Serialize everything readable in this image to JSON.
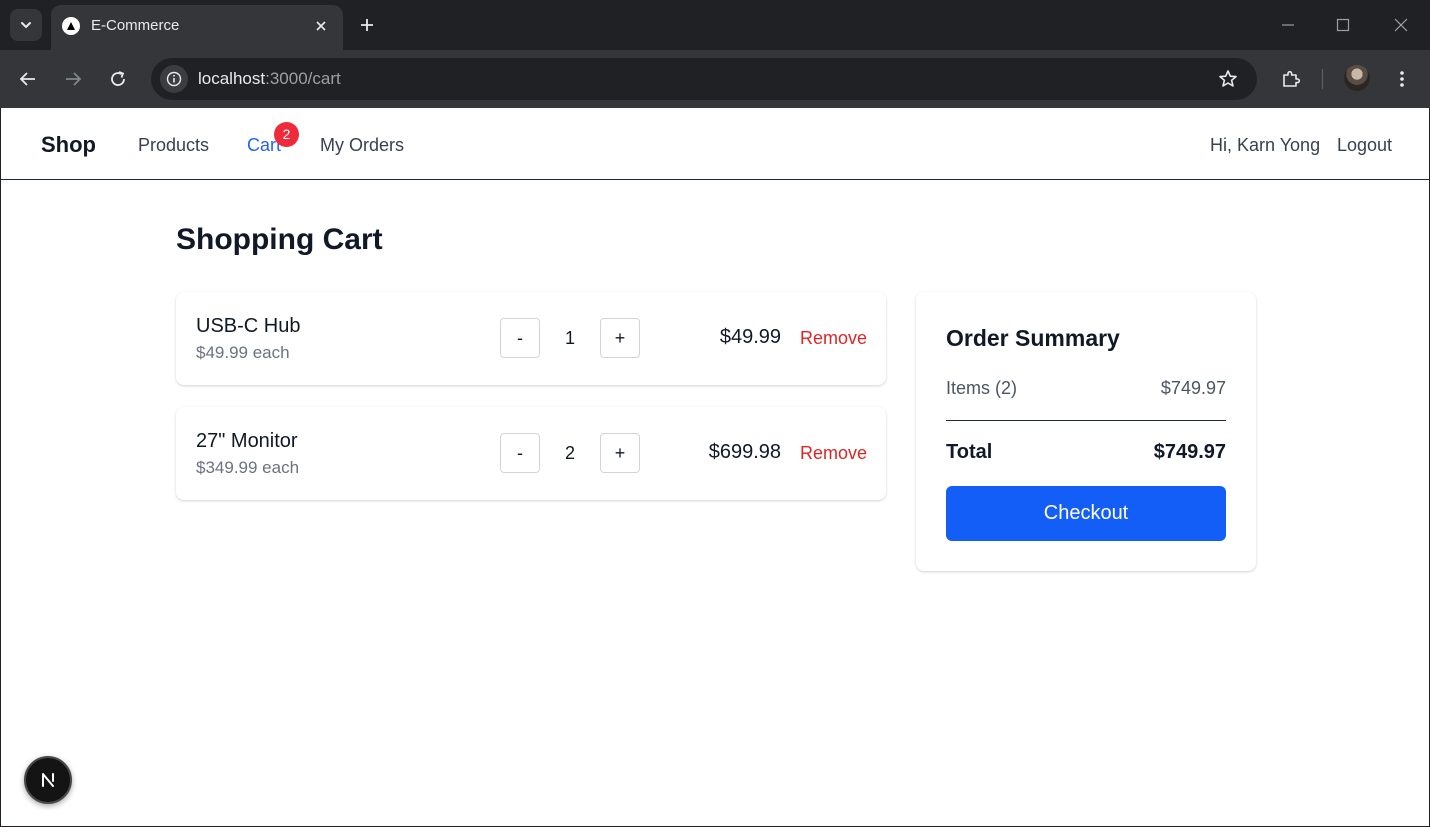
{
  "browser": {
    "tab_title": "E-Commerce",
    "url_host": "localhost",
    "url_path": ":3000/cart"
  },
  "nav": {
    "brand": "Shop",
    "products": "Products",
    "cart": "Cart",
    "cart_count": "2",
    "orders": "My Orders",
    "greeting": "Hi, Karn Yong",
    "logout": "Logout"
  },
  "page": {
    "title": "Shopping Cart"
  },
  "cart": {
    "items": [
      {
        "name": "USB-C Hub",
        "each": "$49.99 each",
        "qty": "1",
        "line_total": "$49.99",
        "minus": "-",
        "plus": "+",
        "remove": "Remove"
      },
      {
        "name": "27\" Monitor",
        "each": "$349.99 each",
        "qty": "2",
        "line_total": "$699.98",
        "minus": "-",
        "plus": "+",
        "remove": "Remove"
      }
    ]
  },
  "summary": {
    "title": "Order Summary",
    "items_label": "Items (2)",
    "items_value": "$749.97",
    "total_label": "Total",
    "total_value": "$749.97",
    "checkout": "Checkout"
  },
  "icons": {
    "next_dev": "N"
  },
  "colors": {
    "primary": "#135ef7",
    "link_active": "#2563eb",
    "danger": "#dc2626",
    "badge": "#ef2a3a"
  }
}
